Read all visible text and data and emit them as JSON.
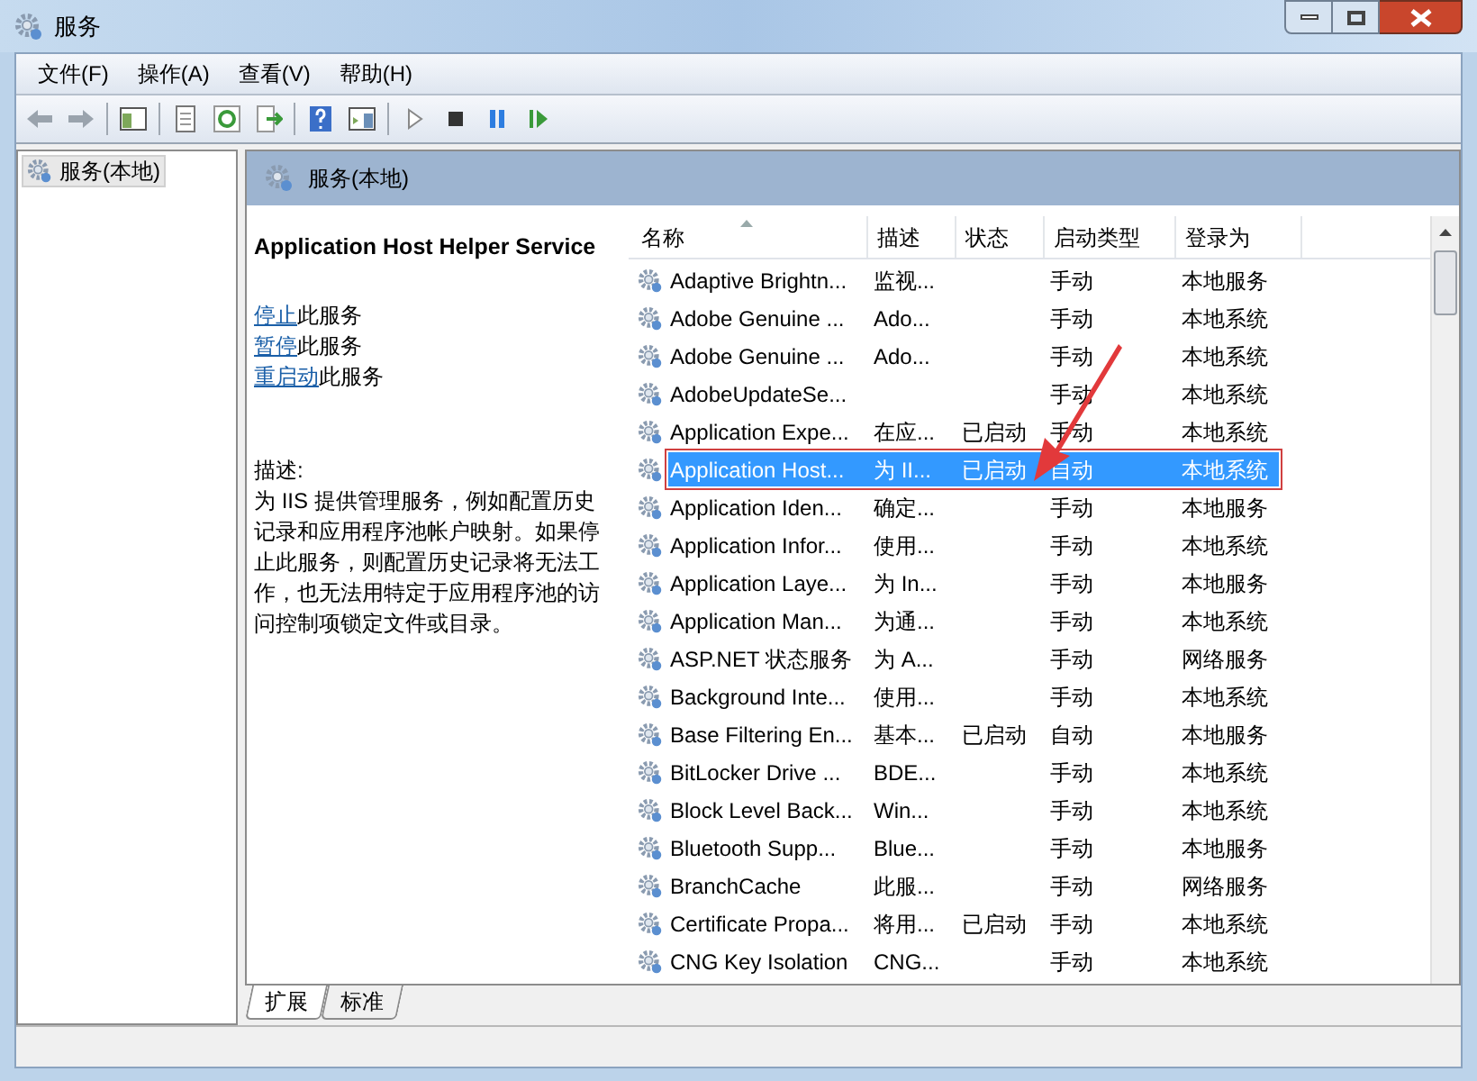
{
  "window": {
    "title": "服务"
  },
  "menu": [
    "文件(F)",
    "操作(A)",
    "查看(V)",
    "帮助(H)"
  ],
  "tree": [
    {
      "label": "服务(本地)",
      "selected": true
    }
  ],
  "panel_header": "服务(本地)",
  "detail": {
    "title": "Application Host Helper Service",
    "actions": [
      {
        "link": "停止",
        "rest": "此服务"
      },
      {
        "link": "暂停",
        "rest": "此服务"
      },
      {
        "link": "重启动",
        "rest": "此服务"
      }
    ],
    "desc_label": "描述:",
    "description": "为 IIS 提供管理服务，例如配置历史记录和应用程序池帐户映射。如果停止此服务，则配置历史记录将无法工作，也无法用特定于应用程序池的访问控制项锁定文件或目录。"
  },
  "table": {
    "columns": [
      "名称",
      "描述",
      "状态",
      "启动类型",
      "登录为"
    ],
    "rows": [
      {
        "name": "Adaptive Brightn...",
        "desc": "监视...",
        "status": "",
        "startup": "手动",
        "logon": "本地服务",
        "selected": false
      },
      {
        "name": "Adobe Genuine ...",
        "desc": "Ado...",
        "status": "",
        "startup": "手动",
        "logon": "本地系统",
        "selected": false
      },
      {
        "name": "Adobe Genuine ...",
        "desc": "Ado...",
        "status": "",
        "startup": "手动",
        "logon": "本地系统",
        "selected": false
      },
      {
        "name": "AdobeUpdateSe...",
        "desc": "",
        "status": "",
        "startup": "手动",
        "logon": "本地系统",
        "selected": false
      },
      {
        "name": "Application Expe...",
        "desc": "在应...",
        "status": "已启动",
        "startup": "手动",
        "logon": "本地系统",
        "selected": false
      },
      {
        "name": "Application Host...",
        "desc": "为 II...",
        "status": "已启动",
        "startup": "自动",
        "logon": "本地系统",
        "selected": true
      },
      {
        "name": "Application Iden...",
        "desc": "确定...",
        "status": "",
        "startup": "手动",
        "logon": "本地服务",
        "selected": false
      },
      {
        "name": "Application Infor...",
        "desc": "使用...",
        "status": "",
        "startup": "手动",
        "logon": "本地系统",
        "selected": false
      },
      {
        "name": "Application Laye...",
        "desc": "为 In...",
        "status": "",
        "startup": "手动",
        "logon": "本地服务",
        "selected": false
      },
      {
        "name": "Application Man...",
        "desc": "为通...",
        "status": "",
        "startup": "手动",
        "logon": "本地系统",
        "selected": false
      },
      {
        "name": "ASP.NET 状态服务",
        "desc": "为 A...",
        "status": "",
        "startup": "手动",
        "logon": "网络服务",
        "selected": false
      },
      {
        "name": "Background Inte...",
        "desc": "使用...",
        "status": "",
        "startup": "手动",
        "logon": "本地系统",
        "selected": false
      },
      {
        "name": "Base Filtering En...",
        "desc": "基本...",
        "status": "已启动",
        "startup": "自动",
        "logon": "本地服务",
        "selected": false
      },
      {
        "name": "BitLocker Drive ...",
        "desc": "BDE...",
        "status": "",
        "startup": "手动",
        "logon": "本地系统",
        "selected": false
      },
      {
        "name": "Block Level Back...",
        "desc": "Win...",
        "status": "",
        "startup": "手动",
        "logon": "本地系统",
        "selected": false
      },
      {
        "name": "Bluetooth Supp...",
        "desc": "Blue...",
        "status": "",
        "startup": "手动",
        "logon": "本地服务",
        "selected": false
      },
      {
        "name": "BranchCache",
        "desc": "此服...",
        "status": "",
        "startup": "手动",
        "logon": "网络服务",
        "selected": false
      },
      {
        "name": "Certificate Propa...",
        "desc": "将用...",
        "status": "已启动",
        "startup": "手动",
        "logon": "本地系统",
        "selected": false
      },
      {
        "name": "CNG Key Isolation",
        "desc": "CNG...",
        "status": "",
        "startup": "手动",
        "logon": "本地系统",
        "selected": false
      }
    ]
  },
  "bottom_tabs": [
    {
      "label": "扩展",
      "selected": true
    },
    {
      "label": "标准",
      "selected": false
    }
  ]
}
